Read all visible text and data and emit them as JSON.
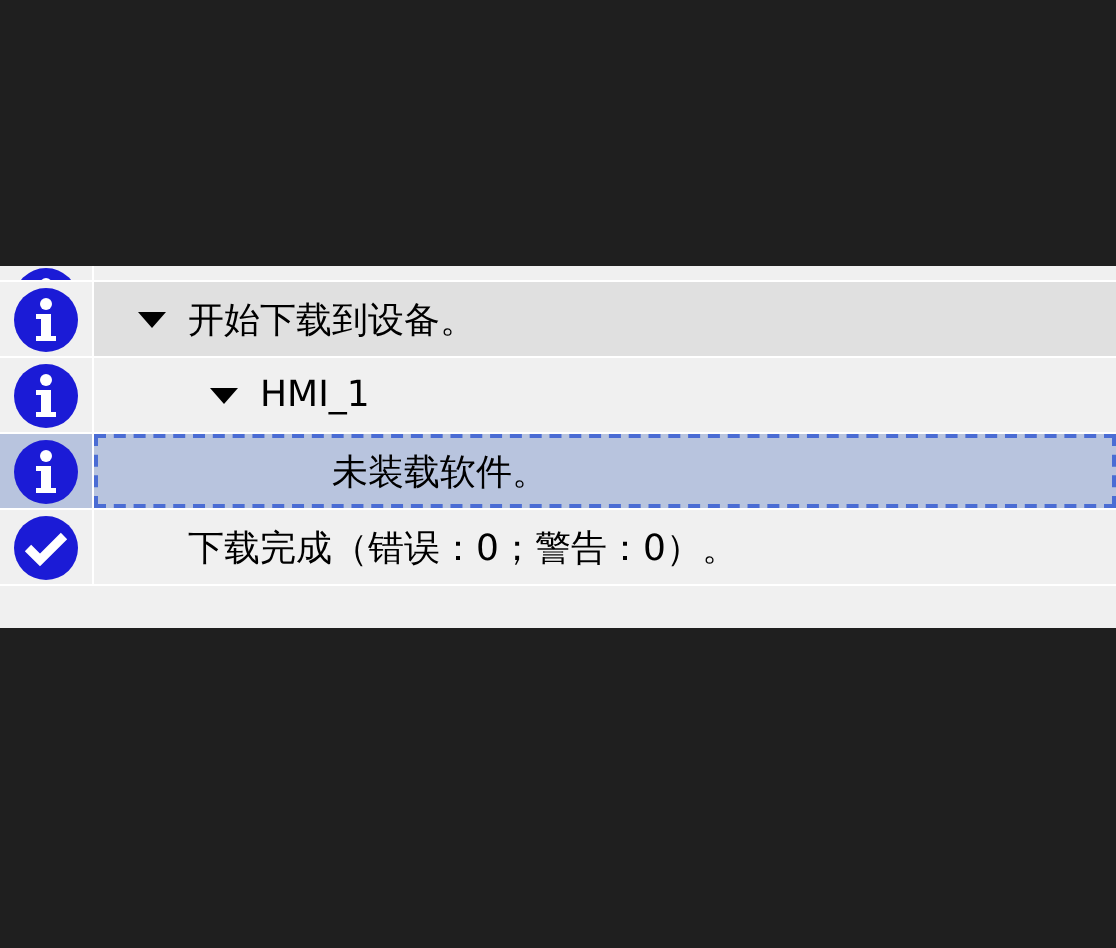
{
  "partial_row": {
    "kind": "info"
  },
  "messages": [
    {
      "kind": "info",
      "text": "开始下载到设备。",
      "expanded": true,
      "hovered": true,
      "selected": false,
      "children": [
        {
          "kind": "info",
          "text": "HMI_1",
          "expanded": true,
          "hovered": false,
          "selected": false,
          "children": [
            {
              "kind": "info",
              "text": "未装载软件。",
              "hovered": false,
              "selected": true
            }
          ]
        }
      ]
    },
    {
      "kind": "success",
      "text": "下载完成（错误：0；警告：0）。",
      "hovered": false,
      "selected": false
    }
  ]
}
